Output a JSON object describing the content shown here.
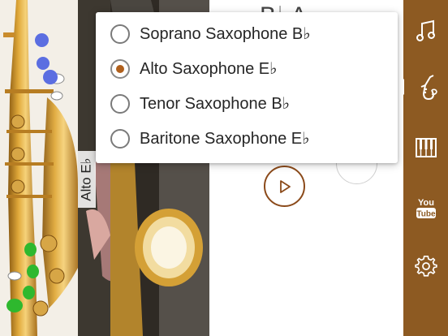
{
  "instrument_label": "Alto E♭",
  "main": {
    "title_peek": "B♭A"
  },
  "menu": {
    "options": [
      {
        "label": "Soprano Saxophone B♭",
        "selected": false
      },
      {
        "label": "Alto Saxophone E♭",
        "selected": true
      },
      {
        "label": "Tenor Saxophone B♭",
        "selected": false
      },
      {
        "label": "Baritone Saxophone E♭",
        "selected": false
      }
    ]
  },
  "sidebar": {
    "items": [
      {
        "icon": "music-note-icon"
      },
      {
        "icon": "saxophone-icon"
      },
      {
        "icon": "piano-keys-icon"
      },
      {
        "icon": "youtube-icon",
        "text": "You Tube"
      },
      {
        "icon": "gear-icon"
      }
    ]
  },
  "colors": {
    "accent": "#b0601c",
    "sidebar": "#8d5a22",
    "play_border": "#8b4a1a",
    "key_blue": "#5b6ee1",
    "key_green": "#2eb82e"
  }
}
